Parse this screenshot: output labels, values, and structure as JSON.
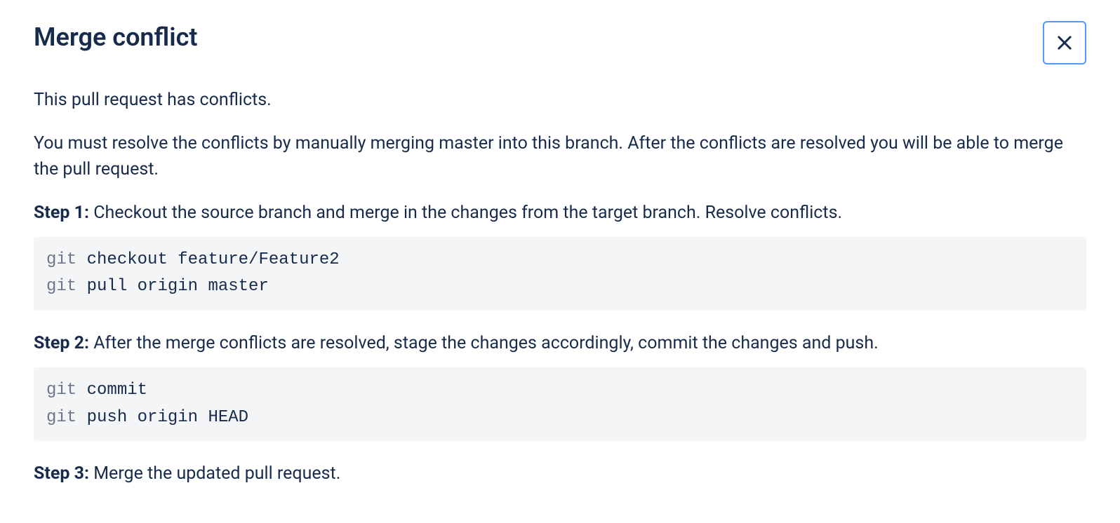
{
  "dialog": {
    "title": "Merge conflict",
    "intro1": "This pull request has conflicts.",
    "intro2": "You must resolve the conflicts by manually merging master into this branch. After the conflicts are resolved you will be able to merge the pull request.",
    "step1": {
      "label": "Step 1:",
      "text": " Checkout the source branch and merge in the changes from the target branch. Resolve conflicts.",
      "code_line1_kw": "git",
      "code_line1_rest": " checkout feature/Feature2",
      "code_line2_kw": "git",
      "code_line2_rest": " pull origin master"
    },
    "step2": {
      "label": "Step 2:",
      "text": " After the merge conflicts are resolved, stage the changes accordingly, commit the changes and push.",
      "code_line1_kw": "git",
      "code_line1_rest": " commit",
      "code_line2_kw": "git",
      "code_line2_rest": " push origin HEAD"
    },
    "step3": {
      "label": "Step 3:",
      "text": " Merge the updated pull request."
    }
  }
}
